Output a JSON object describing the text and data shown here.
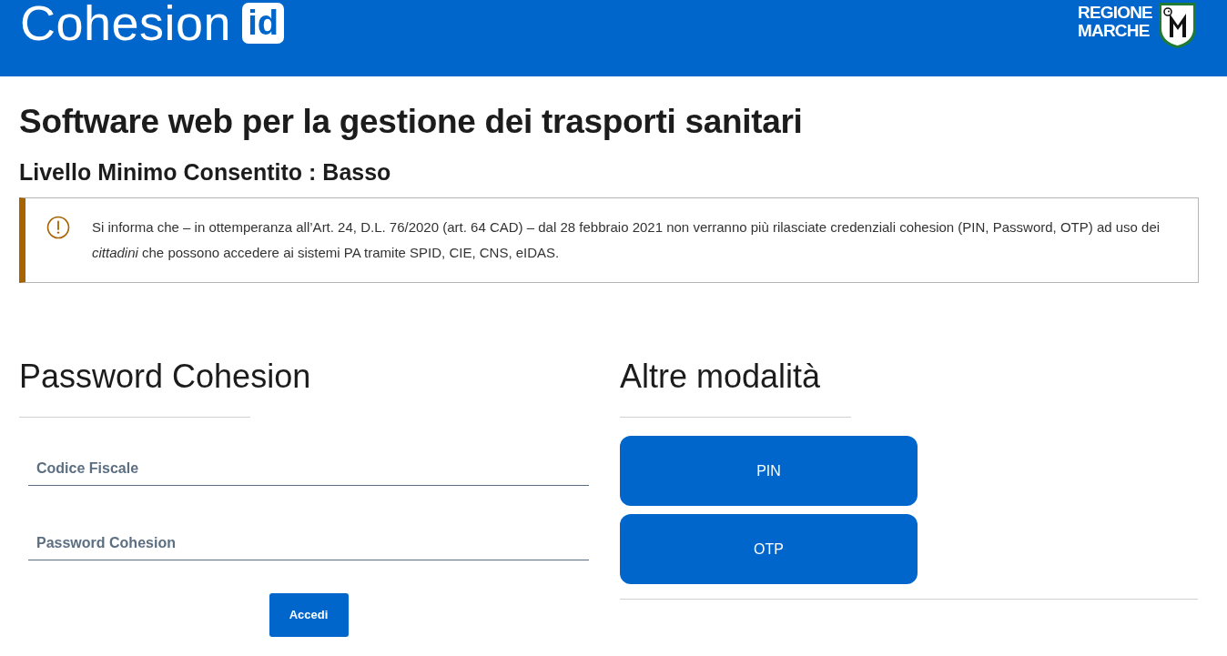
{
  "header": {
    "logo": {
      "text": "Cohesion",
      "badge": "id"
    },
    "region_logo": {
      "lines": [
        "REGIONE",
        "MARCHE"
      ]
    }
  },
  "title": "Software web per la gestione dei trasporti sanitari",
  "subtitle": "Livello Minimo Consentito : Basso",
  "notice": {
    "text": "Si informa che – in ottemperanza all’Art. 24, D.L. 76/2020 (art. 64 CAD) – dal 28 febbraio 2021 non verranno più rilasciate credenziali cohesion (PIN, Password, OTP) ad uso dei *cittadini* che possono accedere ai sistemi PA tramite SPID, CIE, CNS, eIDAS."
  },
  "login_form": {
    "heading": "Password Cohesion",
    "fields": [
      {
        "placeholder": "Codice Fiscale"
      },
      {
        "placeholder": "Password Cohesion"
      }
    ],
    "submit": "Accedi"
  },
  "other_methods": {
    "heading": "Altre modalità",
    "buttons": [
      "PIN",
      "OTP"
    ]
  }
}
